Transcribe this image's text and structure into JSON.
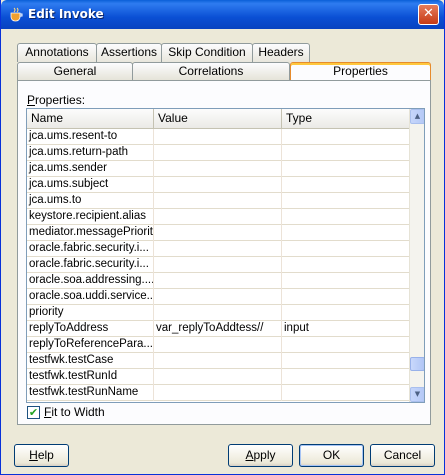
{
  "window": {
    "title": "Edit Invoke",
    "close_glyph": "✕"
  },
  "tabs_row1": [
    "Annotations",
    "Assertions",
    "Skip Condition",
    "Headers"
  ],
  "tabs_row2": [
    "General",
    "Correlations",
    "Properties"
  ],
  "active_tab": "Properties",
  "properties_label": "Properties:",
  "table": {
    "columns": [
      "Name",
      "Value",
      "Type"
    ],
    "rows": [
      [
        "jca.ums.resent-to",
        "",
        ""
      ],
      [
        "jca.ums.return-path",
        "",
        ""
      ],
      [
        "jca.ums.sender",
        "",
        ""
      ],
      [
        "jca.ums.subject",
        "",
        ""
      ],
      [
        "jca.ums.to",
        "",
        ""
      ],
      [
        "keystore.recipient.alias",
        "",
        ""
      ],
      [
        "mediator.messagePriority",
        "",
        ""
      ],
      [
        "oracle.fabric.security.i...",
        "",
        ""
      ],
      [
        "oracle.fabric.security.i...",
        "",
        ""
      ],
      [
        "oracle.soa.addressing....",
        "",
        ""
      ],
      [
        "oracle.soa.uddi.service...",
        "",
        ""
      ],
      [
        "priority",
        "",
        ""
      ],
      [
        "replyToAddress",
        "var_replyToAddtess//",
        "input"
      ],
      [
        "replyToReferencePara...",
        "",
        ""
      ],
      [
        "testfwk.testCase",
        "",
        ""
      ],
      [
        "testfwk.testRunId",
        "",
        ""
      ],
      [
        "testfwk.testRunName",
        "",
        ""
      ]
    ]
  },
  "fit_to_width": {
    "label": "Fit to Width",
    "checked": true
  },
  "buttons": {
    "help": "Help",
    "apply": "Apply",
    "ok": "OK",
    "cancel": "Cancel"
  },
  "colors": {
    "titlebar": "#0a4fd4",
    "active_tab_accent": "#ffc73c",
    "dialog_bg": "#ece9d8"
  }
}
